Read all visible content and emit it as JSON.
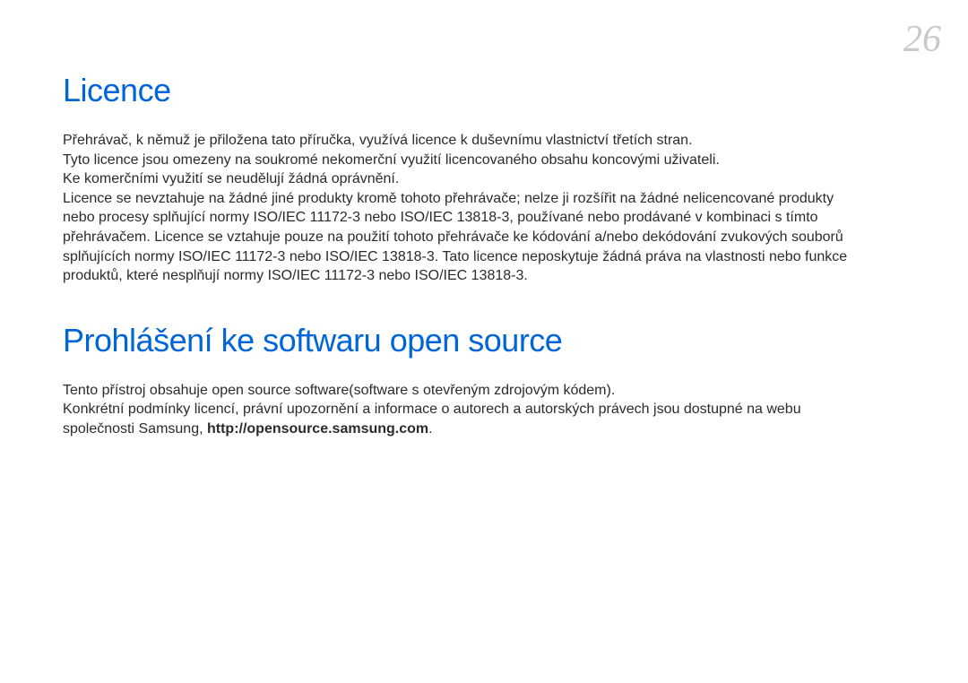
{
  "page_number": "26",
  "section1": {
    "title": "Licence",
    "p1": "Přehrávač, k němuž je přiložena tato příručka, využívá licence k duševnímu vlastnictví třetích stran.",
    "p2": "Tyto licence jsou omezeny na soukromé nekomerční využití licencovaného obsahu koncovými uživateli.",
    "p3": "Ke komerčními využití se neudělují žádná oprávnění.",
    "p4": "Licence se nevztahuje na žádné jiné produkty kromě tohoto přehrávače; nelze ji rozšířit na žádné nelicencované produkty nebo procesy splňující normy ISO/IEC 11172-3 nebo ISO/IEC 13818-3, používané nebo prodávané v kombinaci s tímto přehrávačem. Licence se vztahuje pouze na použití tohoto přehrávače ke kódování a/nebo dekódování zvukových souborů splňujících normy ISO/IEC 11172-3 nebo ISO/IEC 13818-3. Tato licence neposkytuje žádná práva na vlastnosti nebo funkce produktů, které nesplňují normy ISO/IEC 11172-3 nebo ISO/IEC 13818-3."
  },
  "section2": {
    "title": "Prohlášení ke softwaru open source",
    "p1": "Tento přístroj obsahuje open source software(software s otevřeným zdrojovým kódem).",
    "p2_part1": "Konkrétní podmínky licencí, právní upozornění a informace o autorech a autorských právech jsou dostupné na webu společnosti Samsung, ",
    "p2_url": "http://opensource.samsung.com",
    "p2_part2": "."
  }
}
